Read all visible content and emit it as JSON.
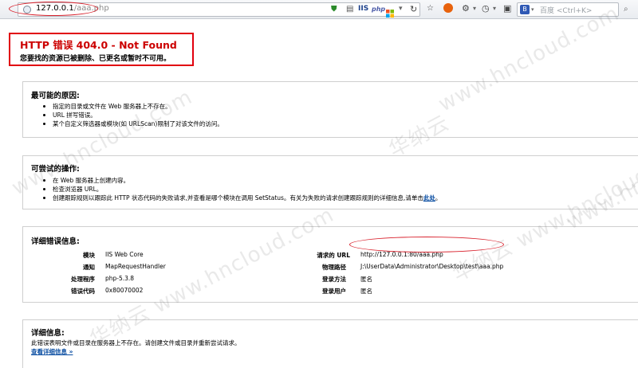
{
  "browser": {
    "url_host": "127.0.0.1",
    "url_path": "/aaa.php",
    "addon_iis": "IIS",
    "addon_php": "php",
    "search_engine": "百度",
    "search_placeholder": "<Ctrl+K>",
    "accent_red": "#d9232e"
  },
  "error": {
    "title": "HTTP 错误 404.0 - Not Found",
    "subtitle": "您要找的资源已被删除、已更名或暂时不可用。"
  },
  "causes": {
    "title": "最可能的原因:",
    "items": [
      "指定的目录或文件在 Web 服务器上不存在。",
      "URL 拼写错误。",
      "某个自定义筛选器或模块(如 URLScan)限制了对该文件的访问。"
    ]
  },
  "actions": {
    "title": "可尝试的操作:",
    "items": [
      "在 Web 服务器上创建内容。",
      "检查浏览器 URL。",
      "创建跟踪规则以跟踪此 HTTP 状态代码的失败请求,并查看是哪个模块在调用 SetStatus。有关为失败的请求创建跟踪规则的详细信息,请单击"
    ],
    "link": "此处",
    "link_suffix": "。"
  },
  "detail_error": {
    "title": "详细错误信息:",
    "left": [
      {
        "label": "模块",
        "value": "IIS Web Core"
      },
      {
        "label": "通知",
        "value": "MapRequestHandler"
      },
      {
        "label": "处理程序",
        "value": "php-5.3.8"
      },
      {
        "label": "错误代码",
        "value": "0x80070002"
      }
    ],
    "right": [
      {
        "label": "请求的 URL",
        "value": "http://127.0.0.1:80/aaa.php"
      },
      {
        "label": "物理路径",
        "value": "J:\\UserData\\Administrator\\Desktop\\test\\aaa.php"
      },
      {
        "label": "登录方法",
        "value": "匿名"
      },
      {
        "label": "登录用户",
        "value": "匿名"
      }
    ]
  },
  "more_info": {
    "title": "详细信息:",
    "text": "此错误表明文件或目录在服务器上不存在。请创建文件或目录并重新尝试请求。",
    "link": "查看详细信息 »"
  },
  "watermark": {
    "text_1": "www.hncloud.com",
    "text_2": "华纳云 www.hncloud.com",
    "text_3": "华纳云",
    "text_4": "www.hnc"
  }
}
